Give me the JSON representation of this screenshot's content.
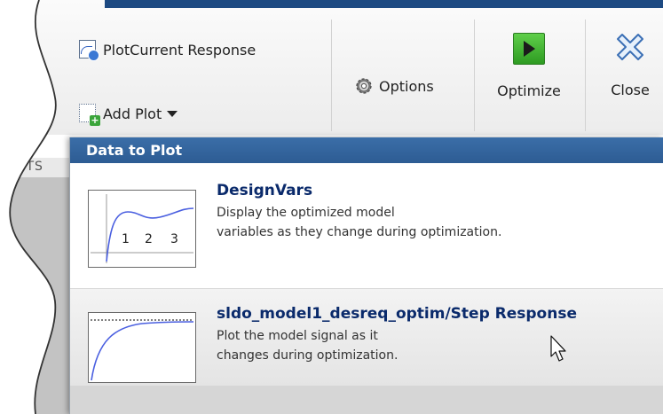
{
  "toolstrip": {
    "plot_current_label": "PlotCurrent Response",
    "add_plot_label": "Add Plot",
    "options_label": "Options",
    "optimize_label": "Optimize",
    "close_label": "Close",
    "section_tab_fragment": "NTS",
    "top_bar_color": "#1d4a82"
  },
  "panel": {
    "header": "Data to Plot",
    "header_color": "#2f5f96",
    "items": [
      {
        "title": "DesignVars",
        "desc_line1": "Display the optimized model",
        "desc_line2": "variables as they change during optimization.",
        "thumb_ticks": [
          "1",
          "2",
          "3"
        ]
      },
      {
        "title": "sldo_model1_desreq_optim/Step Response",
        "desc_line1": "Plot the model signal as it",
        "desc_line2": "changes during optimization."
      }
    ]
  },
  "icons": {
    "plot_current": "plot-response-icon",
    "add_plot": "add-plot-icon",
    "options": "gear-icon",
    "optimize": "run-triangle-icon",
    "close": "close-x-icon",
    "add_plot_dropdown": "caret-down-icon",
    "cursor": "mouse-pointer-icon"
  }
}
